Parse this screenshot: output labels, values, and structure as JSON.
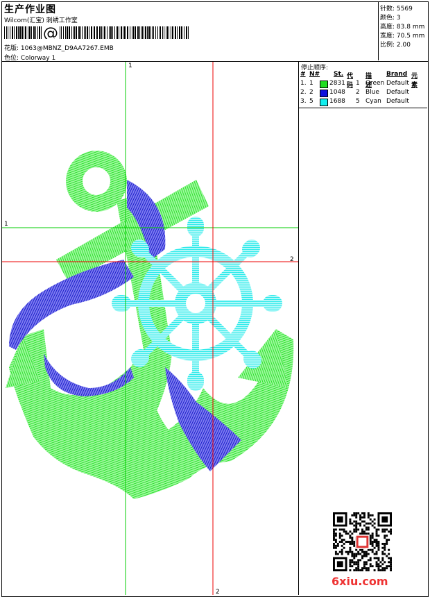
{
  "header": {
    "title": "生产作业图",
    "company": "Wilcom(汇宝) 刺绣工作室",
    "file_label": "花版:",
    "file_name": "1063@MBNZ_D9AA7267.EMB",
    "colorway_label": "色位:",
    "colorway": "Colorway 1"
  },
  "stats": [
    {
      "label": "针数:",
      "value": "5569"
    },
    {
      "label": "颜色:",
      "value": "3"
    },
    {
      "label": "高度:",
      "value": "83.8 mm"
    },
    {
      "label": "宽度:",
      "value": "70.5 mm"
    },
    {
      "label": "比例:",
      "value": "2.00"
    }
  ],
  "stop_sequence": {
    "title": "停止顺序:",
    "headers": {
      "num": "#",
      "n": "N#",
      "st": "St.",
      "code": "代码",
      "desc": "描述",
      "brand": "Brand",
      "elem": "元素"
    },
    "rows": [
      {
        "num": "1.",
        "n": "1",
        "st": "2831",
        "code": "1",
        "desc": "Green",
        "brand": "Default",
        "color": "#22dd22"
      },
      {
        "num": "2.",
        "n": "2",
        "st": "1048",
        "code": "2",
        "desc": "Blue",
        "brand": "Default",
        "color": "#1010dd"
      },
      {
        "num": "3.",
        "n": "5",
        "st": "1688",
        "code": "5",
        "desc": "Cyan",
        "brand": "Default",
        "color": "#11eeee"
      }
    ]
  },
  "guides": {
    "green_v": "1",
    "green_h": "1",
    "red_h": "2",
    "red_v": "2"
  },
  "watermark": "6xiu.com",
  "design_colors": {
    "green": "#22ee22",
    "blue": "#1818cc",
    "cyan": "#22eeee",
    "guide_green": "#00cc00",
    "guide_red": "#ee0000"
  }
}
